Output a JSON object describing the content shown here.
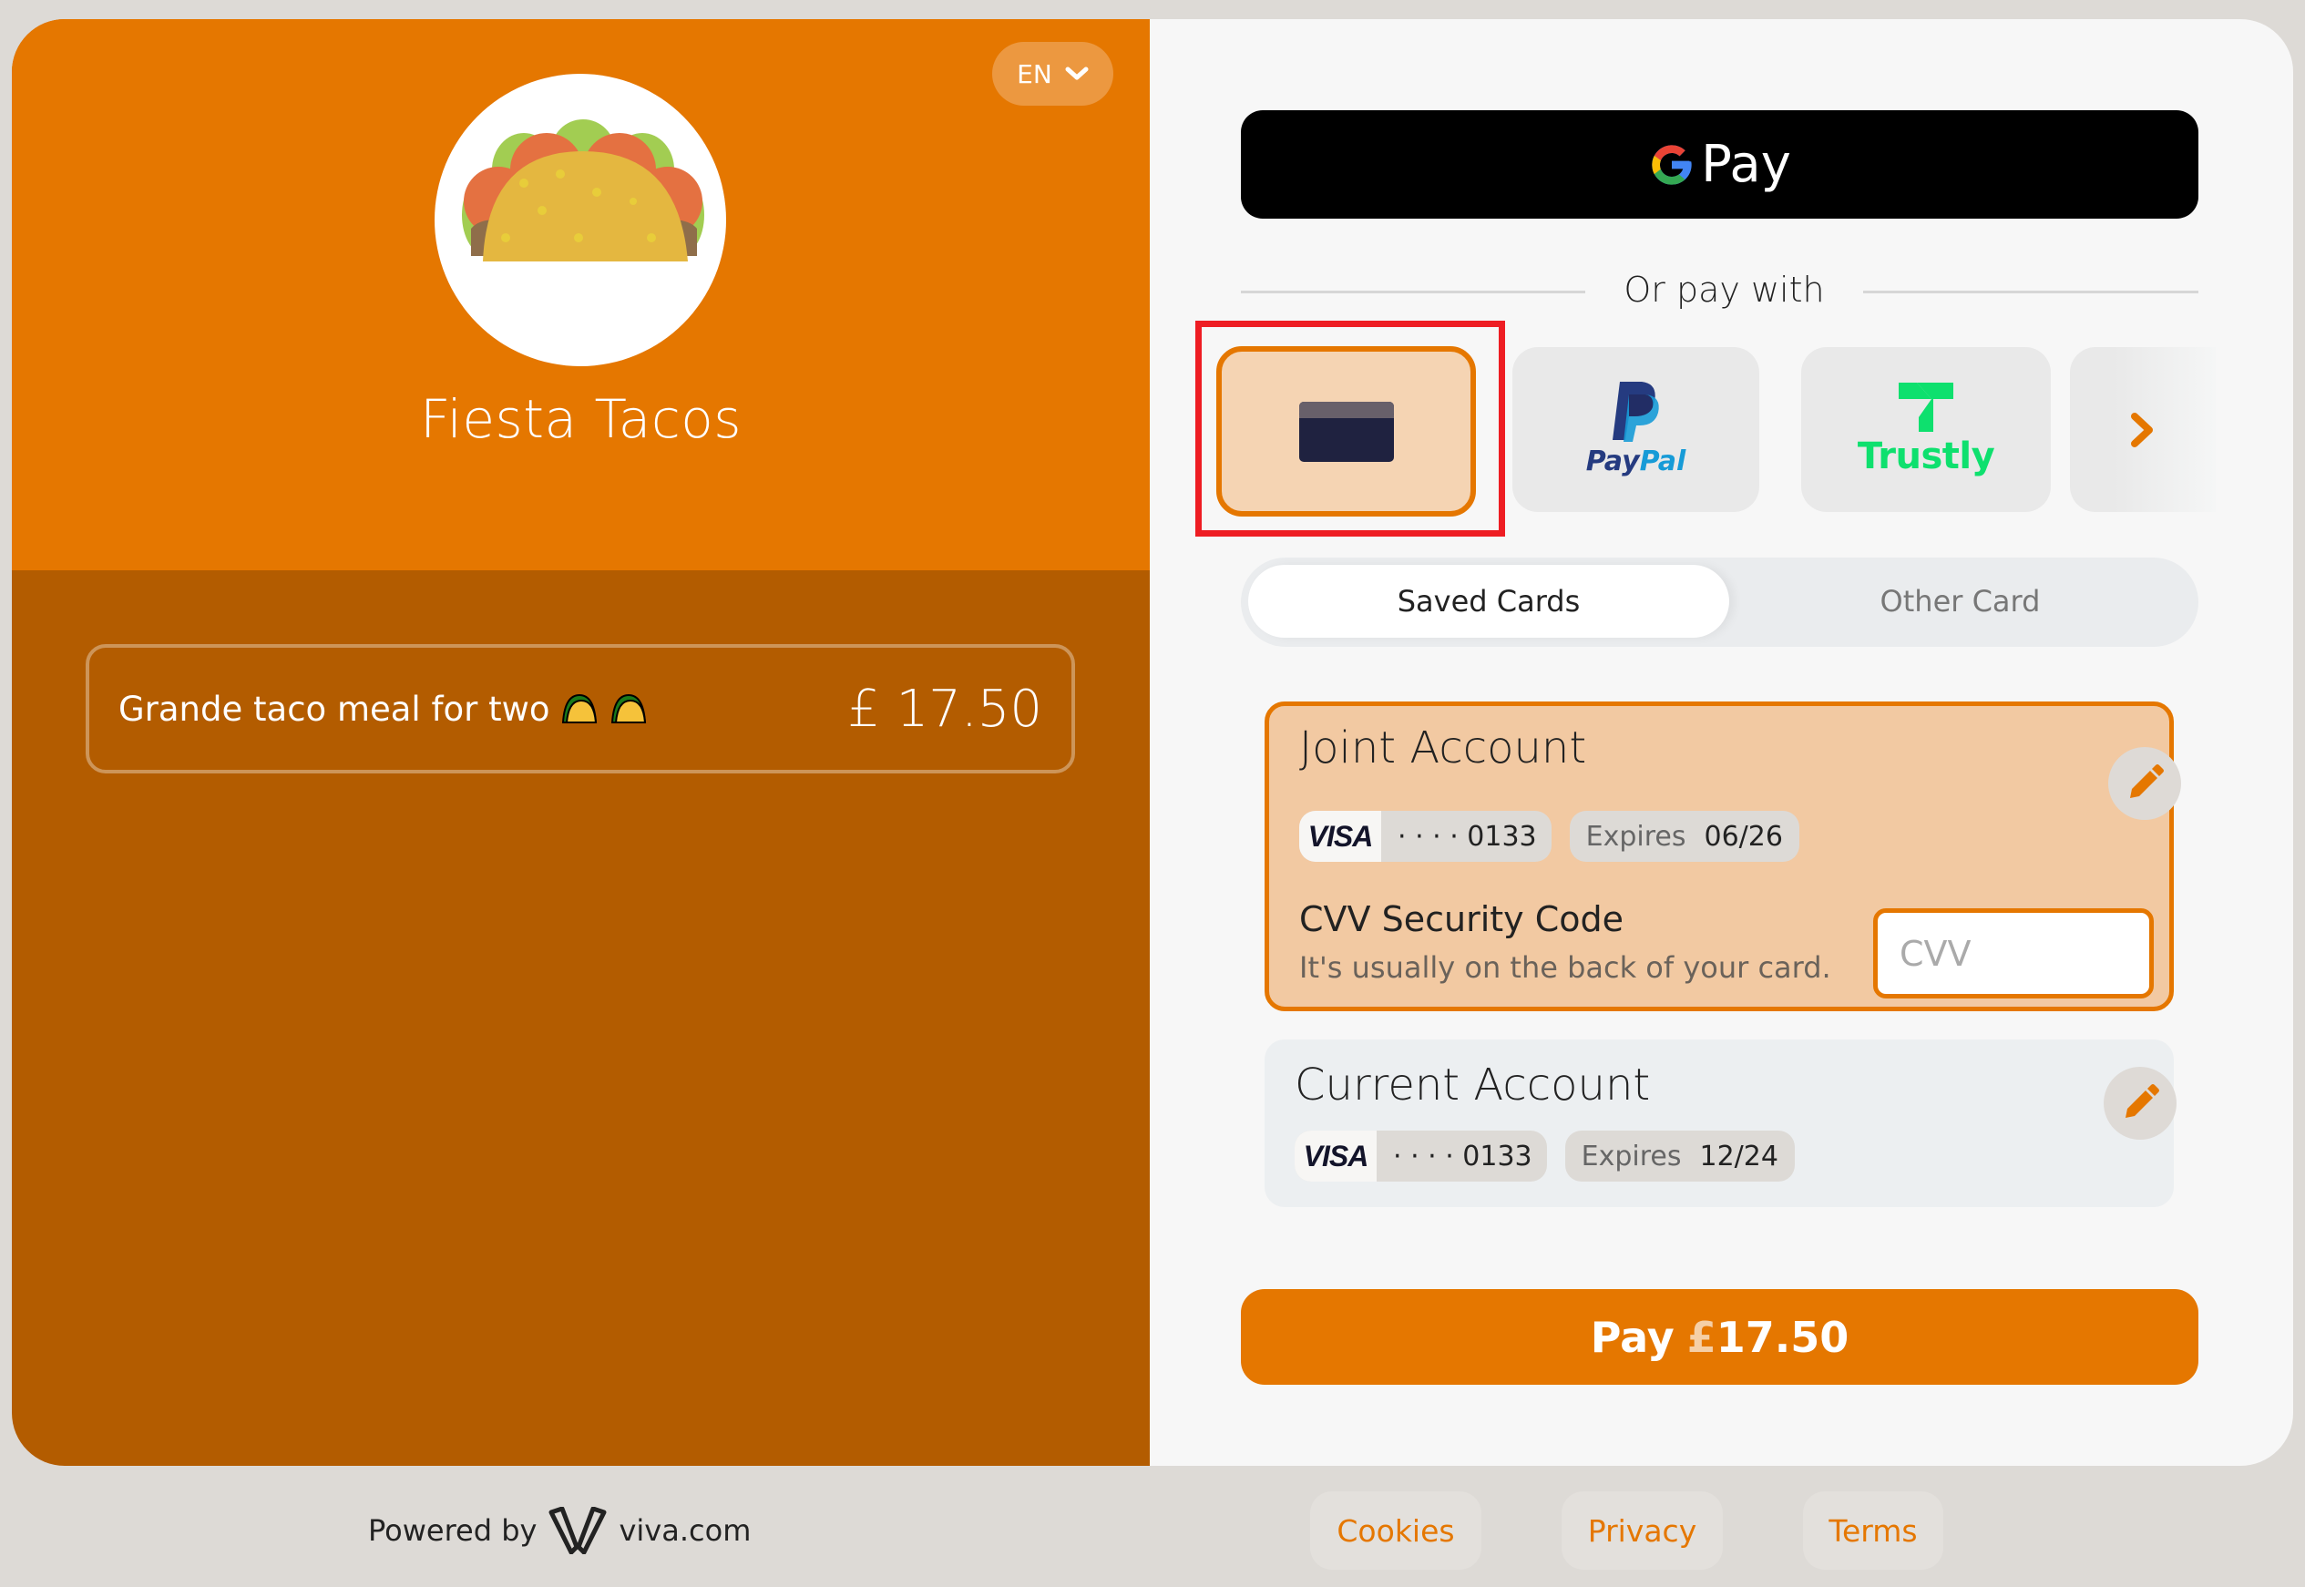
{
  "merchant": {
    "name": "Fiesta Tacos",
    "logo": "taco-logo"
  },
  "language": {
    "selected": "EN",
    "icon": "chevron-down-icon"
  },
  "order": {
    "items": [
      {
        "description": "Grande taco meal for two",
        "emoji": "🌮🌮",
        "price": "£ 17.50"
      }
    ]
  },
  "payment": {
    "gpay_label": "Pay",
    "divider_text": "Or pay with",
    "methods": [
      {
        "id": "card",
        "label": "Card",
        "icon": "credit-card-icon",
        "selected": true
      },
      {
        "id": "paypal",
        "label_a": "Pay",
        "label_b": "Pal",
        "icon": "paypal-icon"
      },
      {
        "id": "trustly",
        "label": "Trustly",
        "icon": "trustly-icon"
      },
      {
        "id": "more",
        "icon": "chevron-right-icon"
      }
    ],
    "tabs": [
      {
        "label": "Saved Cards",
        "active": true
      },
      {
        "label": "Other Card",
        "active": false
      }
    ],
    "saved_cards": [
      {
        "name": "Joint Account",
        "brand": "VISA",
        "masked_number": "· · · · 0133",
        "expires_label": "Expires",
        "expiry": "06/26",
        "selected": true,
        "cvv_label": "CVV Security Code",
        "cvv_hint": "It's usually on the back of your card.",
        "cvv_placeholder": "CVV",
        "cvv_value": ""
      },
      {
        "name": "Current Account",
        "brand": "VISA",
        "masked_number": "· · · · 0133",
        "expires_label": "Expires",
        "expiry": "12/24",
        "selected": false
      }
    ],
    "pay_button": {
      "label": "Pay",
      "currency": "£",
      "amount": "17.50"
    }
  },
  "footer": {
    "powered_by": "Powered by",
    "brand": "viva.com",
    "links": [
      "Cookies",
      "Privacy",
      "Terms"
    ]
  },
  "colors": {
    "brand_orange": "#e57700",
    "dark_orange": "#b35c00",
    "highlight_red": "#ee1d23",
    "selected_card_bg": "#f2c9a2"
  }
}
